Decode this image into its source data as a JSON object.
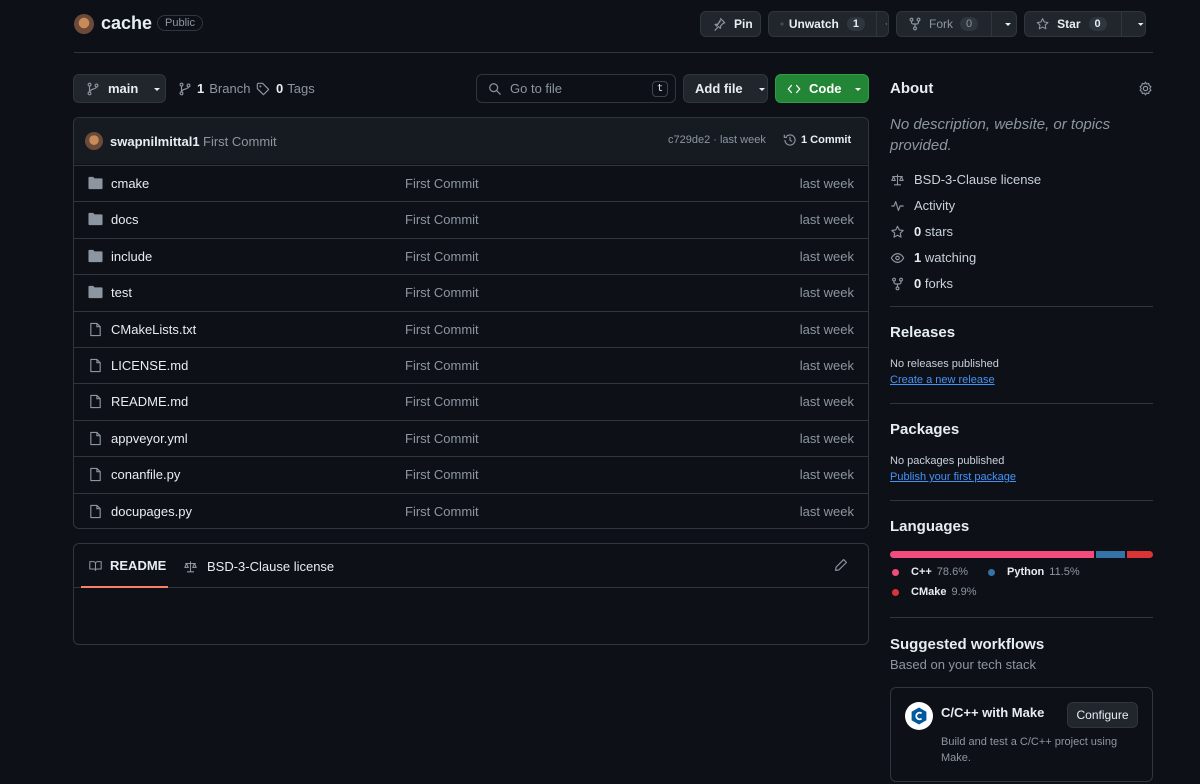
{
  "repo": {
    "name": "cache",
    "visibility": "Public"
  },
  "actions": {
    "pin": "Pin",
    "unwatch": "Unwatch",
    "watch_count": "1",
    "fork": "Fork",
    "fork_count": "0",
    "star": "Star",
    "star_count": "0"
  },
  "toolbar": {
    "branch": "main",
    "branches_count": "1",
    "branches_label": "Branch",
    "tags_count": "0",
    "tags_label": "Tags",
    "search_placeholder": "Go to file",
    "search_shortcut": "t",
    "add_file": "Add file",
    "code": "Code"
  },
  "commit": {
    "author": "swapnilmittal1",
    "message": "First Commit",
    "hash_time": "c729de2 · last week",
    "commits": "1 Commit"
  },
  "files": [
    {
      "name": "cmake",
      "type": "dir",
      "message": "First Commit",
      "time": "last week"
    },
    {
      "name": "docs",
      "type": "dir",
      "message": "First Commit",
      "time": "last week"
    },
    {
      "name": "include",
      "type": "dir",
      "message": "First Commit",
      "time": "last week"
    },
    {
      "name": "test",
      "type": "dir",
      "message": "First Commit",
      "time": "last week"
    },
    {
      "name": "CMakeLists.txt",
      "type": "file",
      "message": "First Commit",
      "time": "last week"
    },
    {
      "name": "LICENSE.md",
      "type": "file",
      "message": "First Commit",
      "time": "last week"
    },
    {
      "name": "README.md",
      "type": "file",
      "message": "First Commit",
      "time": "last week"
    },
    {
      "name": "appveyor.yml",
      "type": "file",
      "message": "First Commit",
      "time": "last week"
    },
    {
      "name": "conanfile.py",
      "type": "file",
      "message": "First Commit",
      "time": "last week"
    },
    {
      "name": "docupages.py",
      "type": "file",
      "message": "First Commit",
      "time": "last week"
    }
  ],
  "readme_tabs": {
    "readme": "README",
    "license": "BSD-3-Clause license"
  },
  "about": {
    "title": "About",
    "description": "No description, website, or topics provided.",
    "license": "BSD-3-Clause license",
    "activity": "Activity",
    "stars_count": "0",
    "stars_label": "stars",
    "watching_count": "1",
    "watching_label": "watching",
    "forks_count": "0",
    "forks_label": "forks"
  },
  "releases": {
    "title": "Releases",
    "empty": "No releases published",
    "link": "Create a new release"
  },
  "packages": {
    "title": "Packages",
    "empty": "No packages published",
    "link": "Publish your first package"
  },
  "languages": {
    "title": "Languages",
    "items": [
      {
        "name": "C++",
        "percent": "78.6%",
        "value": 78.6,
        "color": "#f34b7d"
      },
      {
        "name": "Python",
        "percent": "11.5%",
        "value": 11.5,
        "color": "#3572A5"
      },
      {
        "name": "CMake",
        "percent": "9.9%",
        "value": 9.9,
        "color": "#DA3434"
      }
    ]
  },
  "workflows": {
    "title": "Suggested workflows",
    "subtitle": "Based on your tech stack",
    "card_title": "C/C++ with Make",
    "card_desc": "Build and test a C/C++ project using Make.",
    "configure": "Configure"
  }
}
